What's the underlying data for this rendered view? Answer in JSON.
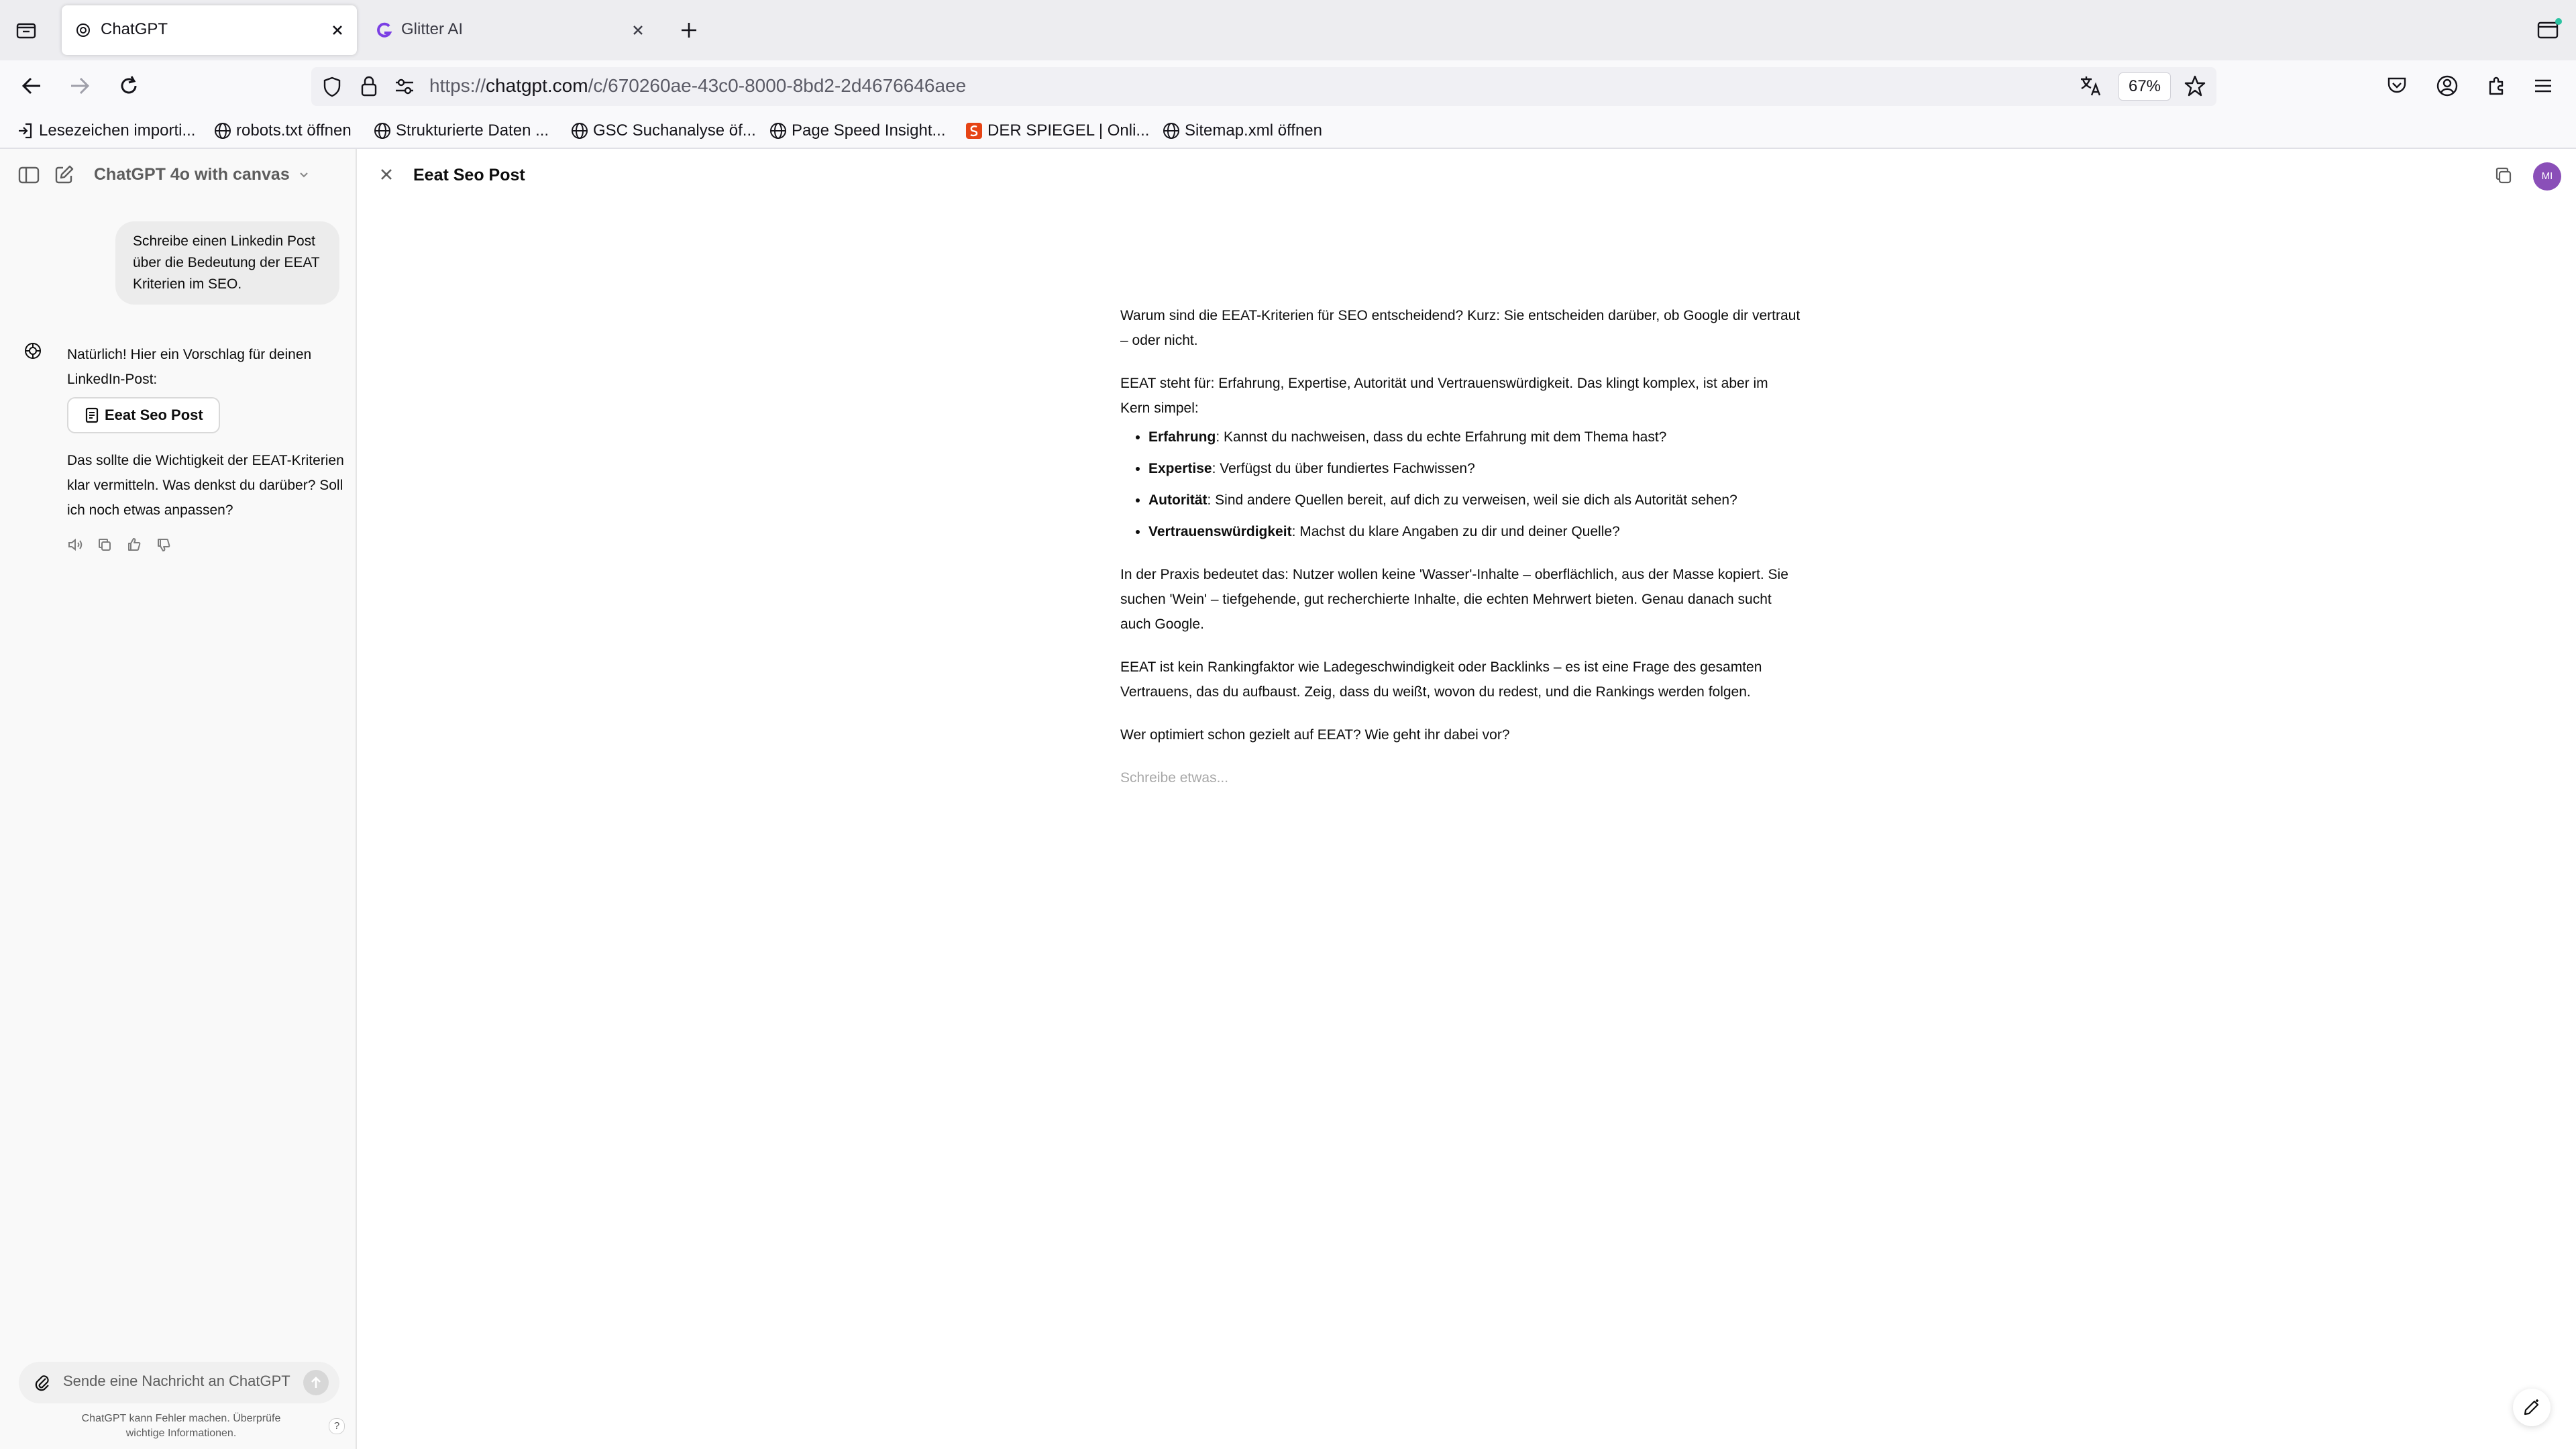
{
  "browser": {
    "tabs": [
      {
        "title": "ChatGPT",
        "active": true
      },
      {
        "title": "Glitter AI",
        "active": false
      }
    ],
    "url": {
      "scheme": "https://",
      "host": "chatgpt.com",
      "path": "/c/670260ae-43c0-8000-8bd2-2d4676646aee"
    },
    "zoom": "67%",
    "bookmarks": [
      {
        "label": "Lesezeichen importi...",
        "icon": "import-icon"
      },
      {
        "label": "robots.txt öffnen",
        "icon": "globe-icon"
      },
      {
        "label": "Strukturierte Daten ...",
        "icon": "globe-icon"
      },
      {
        "label": "GSC Suchanalyse öf...",
        "icon": "globe-icon"
      },
      {
        "label": "Page Speed Insight...",
        "icon": "globe-icon"
      },
      {
        "label": "DER SPIEGEL | Onli...",
        "icon": "spiegel-icon"
      },
      {
        "label": "Sitemap.xml öffnen",
        "icon": "globe-icon"
      }
    ]
  },
  "sidebar": {
    "model_name": "ChatGPT 4o with canvas",
    "user_message": "Schreibe einen Linkedin Post über die Bedeutung der EEAT Kriterien im SEO.",
    "assistant_intro": "Natürlich! Hier ein Vorschlag für deinen LinkedIn-Post:",
    "canvas_button": "Eeat Seo Post",
    "assistant_outro": "Das sollte die Wichtigkeit der EEAT-Kriterien klar vermitteln. Was denkst du darüber? Soll ich noch etwas anpassen?",
    "composer_placeholder": "Sende eine Nachricht an ChatGPT",
    "disclaimer": "ChatGPT kann Fehler machen. Überprüfe wichtige Informationen.",
    "help": "?"
  },
  "canvas": {
    "title": "Eeat Seo Post",
    "avatar_initials": "MI",
    "paragraphs": {
      "p1": "Warum sind die EEAT-Kriterien für SEO entscheidend? Kurz: Sie entscheiden darüber, ob Google dir vertraut – oder nicht.",
      "p2": "EEAT steht für: Erfahrung, Expertise, Autorität und Vertrauenswürdigkeit. Das klingt komplex, ist aber im Kern simpel:",
      "p3": "In der Praxis bedeutet das: Nutzer wollen keine 'Wasser'-Inhalte – oberflächlich, aus der Masse kopiert. Sie suchen 'Wein' – tiefgehende, gut recherchierte Inhalte, die echten Mehrwert bieten. Genau danach sucht auch Google.",
      "p4": "EEAT ist kein Rankingfaktor wie Ladegeschwindigkeit oder Backlinks – es ist eine Frage des gesamten Vertrauens, das du aufbaust. Zeig, dass du weißt, wovon du redest, und die Rankings werden folgen.",
      "p5": "Wer optimiert schon gezielt auf EEAT? Wie geht ihr dabei vor?"
    },
    "bullets": [
      {
        "term": "Erfahrung",
        "text": ": Kannst du nachweisen, dass du echte Erfahrung mit dem Thema hast?"
      },
      {
        "term": "Expertise",
        "text": ": Verfügst du über fundiertes Fachwissen?"
      },
      {
        "term": "Autorität",
        "text": ": Sind andere Quellen bereit, auf dich zu verweisen, weil sie dich als Autorität sehen?"
      },
      {
        "term": "Vertrauenswürdigkeit",
        "text": ": Machst du klare Angaben zu dir und deiner Quelle?"
      }
    ],
    "placeholder": "Schreibe etwas..."
  },
  "colors": {
    "accent_avatar": "#8a4fb8",
    "spiegel": "#e64415",
    "glitter": "#7b3fe4"
  }
}
